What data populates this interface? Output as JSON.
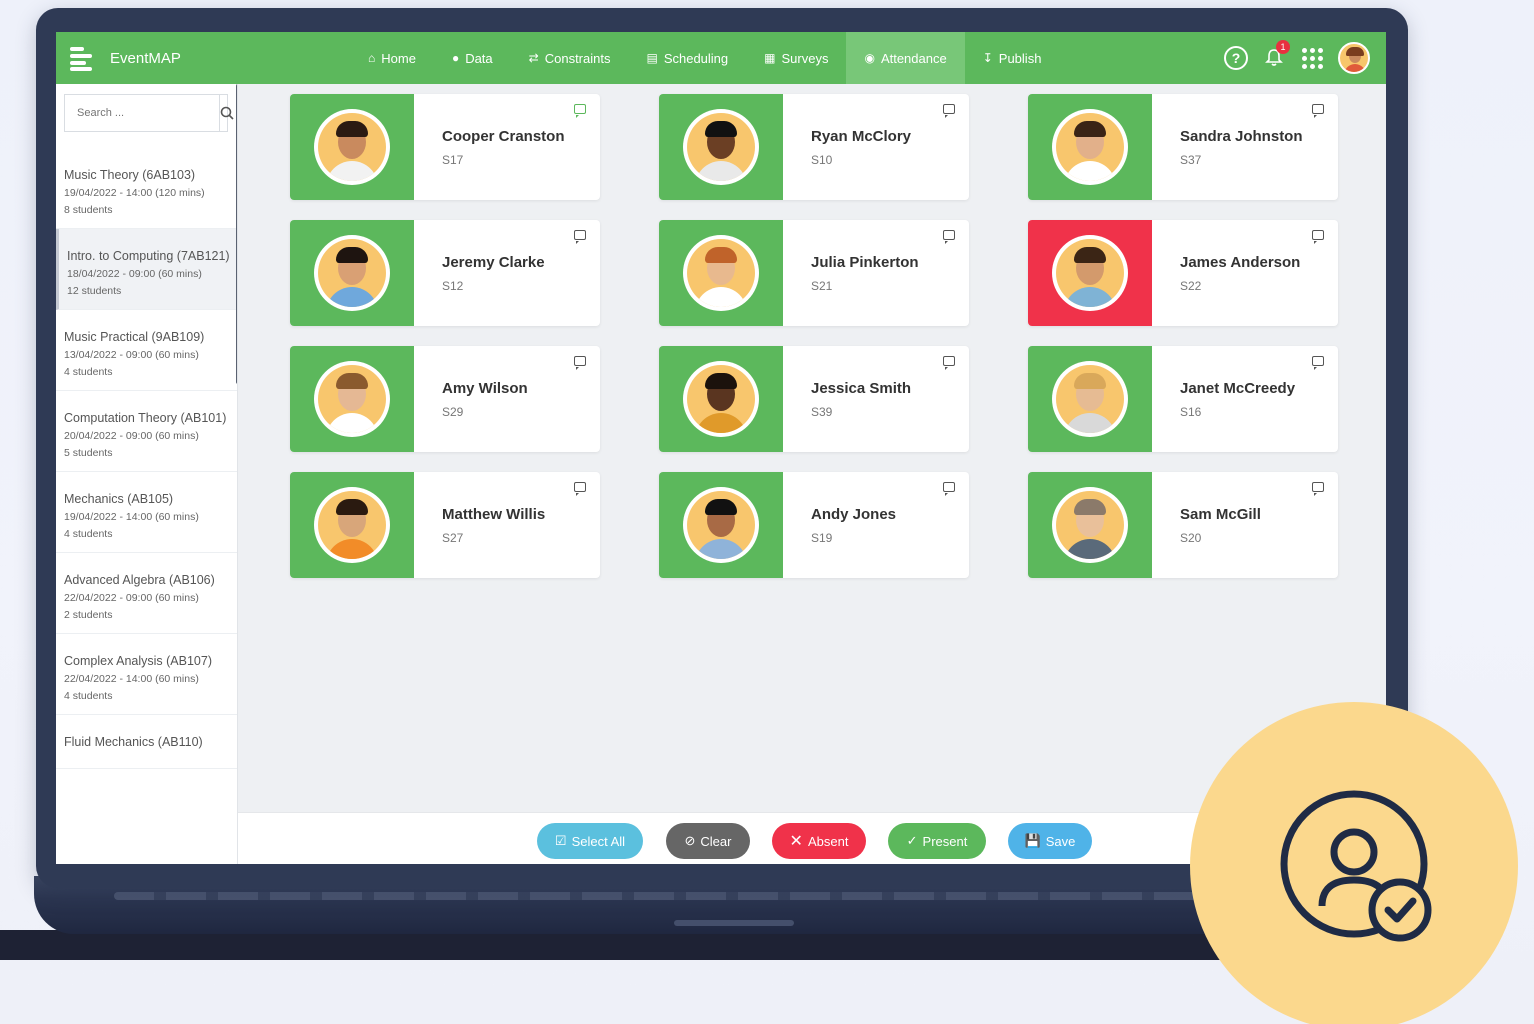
{
  "app": {
    "brand": "EventMAP"
  },
  "nav": {
    "items": [
      {
        "label": "Home",
        "icon": "home-icon"
      },
      {
        "label": "Data",
        "icon": "cube-icon"
      },
      {
        "label": "Constraints",
        "icon": "sliders-icon"
      },
      {
        "label": "Scheduling",
        "icon": "calendar-icon"
      },
      {
        "label": "Surveys",
        "icon": "clipboard-icon"
      },
      {
        "label": "Attendance",
        "icon": "user-icon",
        "active": true
      },
      {
        "label": "Publish",
        "icon": "download-icon"
      }
    ],
    "notifications_count": "1"
  },
  "sidebar": {
    "search_placeholder": "Search ...",
    "courses": [
      {
        "title": "Music Theory (6AB103)",
        "time": "19/04/2022 - 14:00 (120 mins)",
        "count": "8 students"
      },
      {
        "title": "Intro. to Computing (7AB121)",
        "time": "18/04/2022 - 09:00 (60 mins)",
        "count": "12 students",
        "active": true
      },
      {
        "title": "Music Practical (9AB109)",
        "time": "13/04/2022 - 09:00 (60 mins)",
        "count": "4 students"
      },
      {
        "title": "Computation Theory (AB101)",
        "time": "20/04/2022 - 09:00 (60 mins)",
        "count": "5 students"
      },
      {
        "title": "Mechanics (AB105)",
        "time": "19/04/2022 - 14:00 (60 mins)",
        "count": "4 students"
      },
      {
        "title": "Advanced Algebra (AB106)",
        "time": "22/04/2022 - 09:00 (60 mins)",
        "count": "2 students"
      },
      {
        "title": "Complex Analysis (AB107)",
        "time": "22/04/2022 - 14:00 (60 mins)",
        "count": "4 students"
      },
      {
        "title": "Fluid Mechanics (AB110)",
        "time": "",
        "count": ""
      }
    ]
  },
  "students": [
    {
      "name": "Cooper Cranston",
      "code": "S17",
      "status": "present",
      "comment": "green"
    },
    {
      "name": "Ryan McClory",
      "code": "S10",
      "status": "present"
    },
    {
      "name": "Sandra Johnston",
      "code": "S37",
      "status": "present"
    },
    {
      "name": "Jeremy Clarke",
      "code": "S12",
      "status": "present"
    },
    {
      "name": "Julia Pinkerton",
      "code": "S21",
      "status": "present"
    },
    {
      "name": "James Anderson",
      "code": "S22",
      "status": "absent"
    },
    {
      "name": "Amy Wilson",
      "code": "S29",
      "status": "present"
    },
    {
      "name": "Jessica Smith",
      "code": "S39",
      "status": "present"
    },
    {
      "name": "Janet McCreedy",
      "code": "S16",
      "status": "present"
    },
    {
      "name": "Matthew Willis",
      "code": "S27",
      "status": "present"
    },
    {
      "name": "Andy Jones",
      "code": "S19",
      "status": "present"
    },
    {
      "name": "Sam McGill",
      "code": "S20",
      "status": "present"
    }
  ],
  "actions": {
    "select_all": "Select All",
    "clear": "Clear",
    "absent": "Absent",
    "present": "Present",
    "save": "Save"
  },
  "colors": {
    "primary_green": "#5cb85c",
    "absent_red": "#f0324a",
    "select_blue": "#5bc0de",
    "clear_gray": "#666666",
    "save_blue": "#4fb3e8",
    "badge_yellow": "#fbd88d"
  }
}
